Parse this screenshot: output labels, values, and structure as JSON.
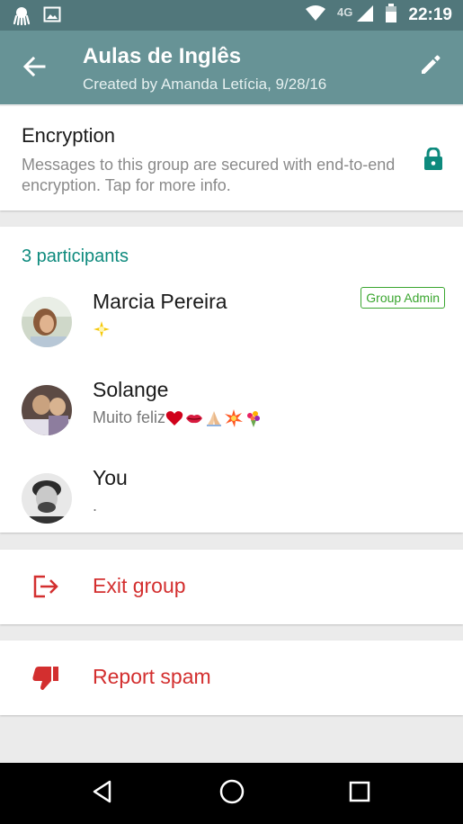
{
  "status_bar": {
    "time": "22:19",
    "network": "4G",
    "icons": [
      "octopus-notification-icon",
      "image-notification-icon",
      "wifi-icon",
      "cell-signal-icon",
      "battery-icon"
    ]
  },
  "header": {
    "title": "Aulas de Inglês",
    "subtitle": "Created by Amanda Letícia, 9/28/16",
    "back_icon": "arrow-left-icon",
    "edit_icon": "pencil-icon",
    "background": "#679396",
    "status_background": "#51777b"
  },
  "encryption": {
    "title": "Encryption",
    "description": "Messages to this group are secured with end-to-end encryption. Tap for more info.",
    "icon": "lock-icon",
    "icon_color": "#0d8a7d"
  },
  "participants": {
    "count_label": "3 participants",
    "items": [
      {
        "name": "Marcia Pereira",
        "status_emojis": [
          "sparkle-star"
        ],
        "status_text": "",
        "badge": "Group Admin"
      },
      {
        "name": "Solange",
        "status_text": "Muito feliz",
        "status_emojis": [
          "red-heart",
          "kiss-lips",
          "praying-hands",
          "collision",
          "bouquet"
        ]
      },
      {
        "name": "You",
        "status_text": "."
      }
    ]
  },
  "actions": {
    "exit_label": "Exit group",
    "exit_icon": "exit-icon",
    "spam_label": "Report spam",
    "spam_icon": "thumbs-down-icon",
    "color": "#d32f2f"
  },
  "nav": {
    "back_icon": "nav-back-icon",
    "home_icon": "nav-home-icon",
    "recents_icon": "nav-recents-icon"
  }
}
